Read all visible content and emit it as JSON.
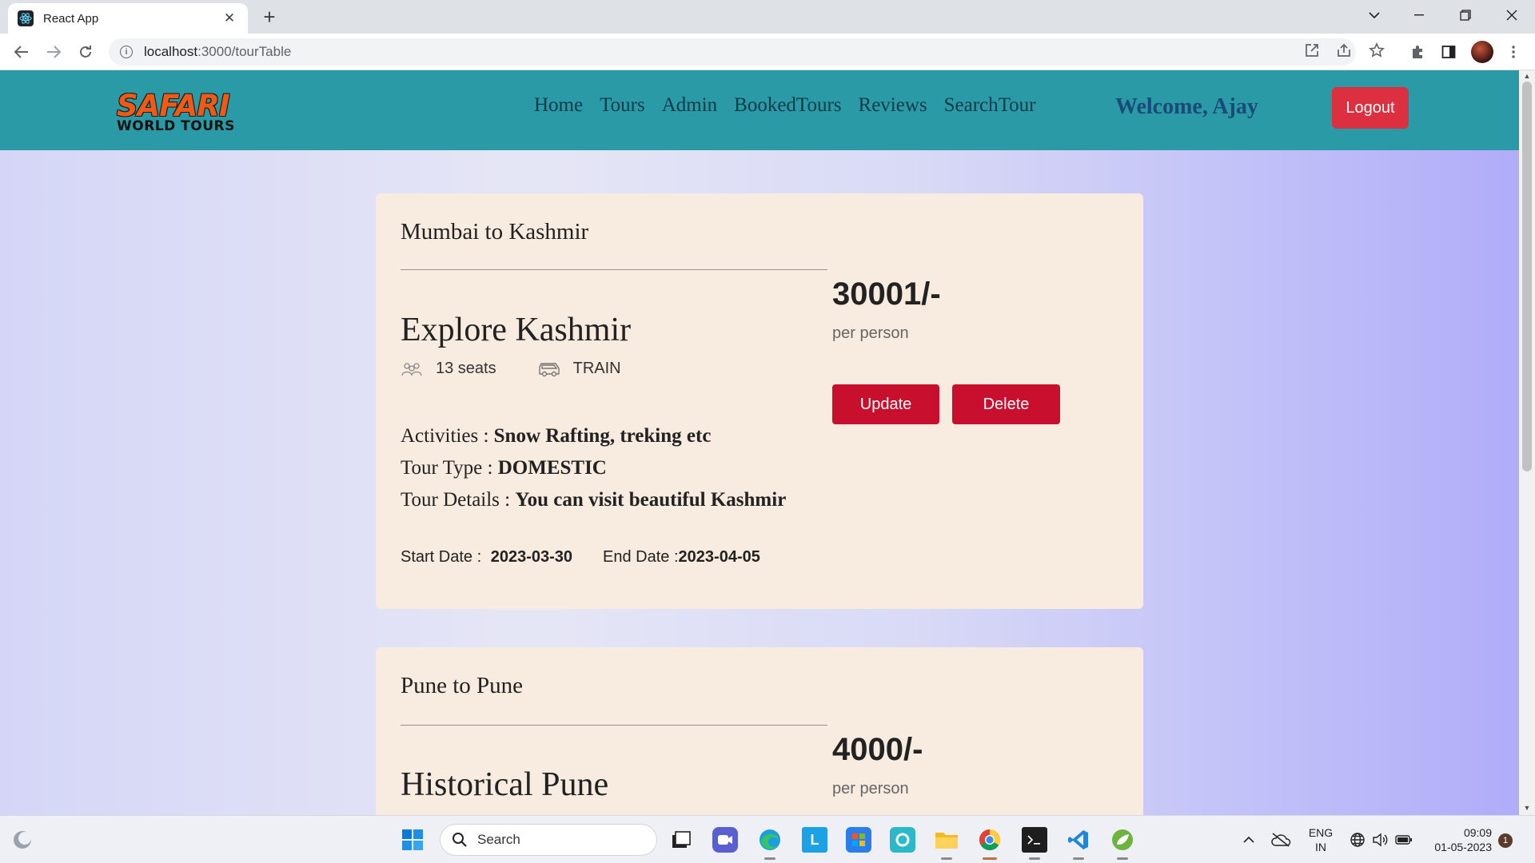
{
  "browser": {
    "tab_title": "React App",
    "url_host": "localhost",
    "url_rest": ":3000/tourTable"
  },
  "navbar": {
    "logo_top": "SAFARI",
    "logo_bottom": "WORLD TOURS",
    "links": [
      "Home",
      "Tours",
      "Admin",
      "BookedTours",
      "Reviews",
      "SearchTour"
    ],
    "welcome": "Welcome, Ajay",
    "logout_label": "Logout"
  },
  "tours": [
    {
      "route": "Mumbai to Kashmir",
      "name": "Explore Kashmir",
      "seats": "13 seats",
      "transport": "TRAIN",
      "activities_label": "Activities : ",
      "activities": "Snow Rafting, treking etc",
      "type_label": "Tour Type : ",
      "type": "DOMESTIC",
      "details_label": "Tour Details : ",
      "details": "You can visit beautiful Kashmir",
      "start_label": "Start Date : ",
      "start_date": "2023-03-30",
      "end_label": "End Date :",
      "end_date": "2023-04-05",
      "price": "30001/-",
      "per_person": "per person",
      "update_label": "Update",
      "delete_label": "Delete"
    },
    {
      "route": "Pune to Pune",
      "name": "Historical Pune",
      "price": "4000/-",
      "per_person": "per person"
    }
  ],
  "taskbar": {
    "search_placeholder": "Search",
    "lang_top": "ENG",
    "lang_bottom": "IN",
    "time": "09:09",
    "date": "01-05-2023",
    "notification_count": "1"
  }
}
